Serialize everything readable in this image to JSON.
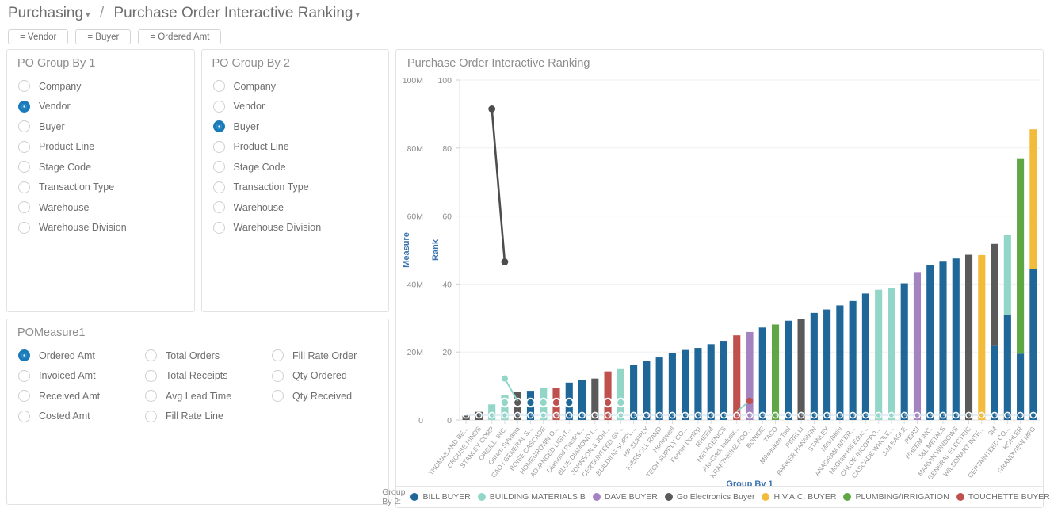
{
  "breadcrumb": {
    "items": [
      {
        "label": "Purchasing",
        "caret": "▾"
      },
      {
        "label": "Purchase Order Interactive Ranking",
        "caret": "▾"
      }
    ],
    "separator": "/"
  },
  "chips": [
    {
      "label": "= Vendor"
    },
    {
      "label": "= Buyer"
    },
    {
      "label": "= Ordered Amt"
    }
  ],
  "group_by_1": {
    "title": "PO Group By 1",
    "selected": "Vendor",
    "options": [
      "Company",
      "Vendor",
      "Buyer",
      "Product Line",
      "Stage Code",
      "Transaction Type",
      "Warehouse",
      "Warehouse Division"
    ]
  },
  "group_by_2": {
    "title": "PO Group By 2",
    "selected": "Buyer",
    "options": [
      "Company",
      "Vendor",
      "Buyer",
      "Product Line",
      "Stage Code",
      "Transaction Type",
      "Warehouse",
      "Warehouse Division"
    ]
  },
  "measure": {
    "title": "POMeasure1",
    "selected": "Ordered Amt",
    "columns": [
      [
        "Ordered Amt",
        "Invoiced Amt",
        "Received Amt",
        "Costed Amt"
      ],
      [
        "Total Orders",
        "Total Receipts",
        "Avg Lead Time",
        "Fill Rate Line"
      ],
      [
        "Fill Rate Order",
        "Qty Ordered",
        "Qty Received"
      ]
    ]
  },
  "chart_panel": {
    "title": "Purchase Order Interactive Ranking"
  },
  "chart_data": {
    "type": "bar",
    "title": "Purchase Order Interactive Ranking",
    "xlabel": "Group By 1",
    "y_left_label": "Measure",
    "y_right_label": "Rank",
    "y_left_ticks": [
      "0",
      "20M",
      "40M",
      "60M",
      "80M",
      "100M"
    ],
    "y_right_ticks": [
      "0",
      "20",
      "40",
      "60",
      "80",
      "100"
    ],
    "ylim": [
      0,
      100
    ],
    "grid": true,
    "legend_position": "bottom",
    "legend_title": "Group By 2:",
    "series_colors": {
      "BILL BUYER": "#1f6699",
      "BUILDING MATERIALS B": "#92d6c8",
      "DAVE BUYER": "#a383c0",
      "Go Electronics Buyer": "#5a5a5a",
      "H.V.A.C. BUYER": "#f2bb3a",
      "PLUMBING/IRRIGATION": "#5fa744",
      "TOUCHETTE BUYER": "#c0504d"
    },
    "legend": [
      {
        "label": "BILL BUYER",
        "color": "#1f6699"
      },
      {
        "label": "BUILDING MATERIALS B",
        "color": "#92d6c8"
      },
      {
        "label": "DAVE BUYER",
        "color": "#a383c0"
      },
      {
        "label": "Go Electronics Buyer",
        "color": "#5a5a5a"
      },
      {
        "label": "H.V.A.C. BUYER",
        "color": "#f2bb3a"
      },
      {
        "label": "PLUMBING/IRRIGATION",
        "color": "#5fa744"
      },
      {
        "label": "TOUCHETTE BUYER",
        "color": "#c0504d"
      }
    ],
    "categories": [
      "THOMAS AND BE...",
      "CROUSE HINDS",
      "STANLEY CORP",
      "ORGILL, INC.",
      "Osram Sylvania",
      "CAO / GENERAL S...",
      "BOISE CASCADE",
      "HOMEGROWN O...",
      "ADVANCED LIGHT...",
      "Diamond Plastics...",
      "BLUE DIAMOND I...",
      "JOHNSON & JOH...",
      "CERTAINTEED GY...",
      "BUILDING SUPPL...",
      "HP SUPPLY",
      "IGERSOLL RAND",
      "Honeywell",
      "TECH SUPPLY CO...",
      "Fenner Dunlop",
      "RHEEM",
      "METAGENICS",
      "Ato-Clark Industr...",
      "KRAFTHEINZ FOO...",
      "BONIDE",
      "TACO",
      "Milwaukee Tool",
      "PIRELLI",
      "PARKER HANNIFIN",
      "STANLEY",
      "Mitsubishi",
      "ANAGRAM INTER...",
      "McGraw-Hill Educ...",
      "CHLOE INCORPO...",
      "CASCADE WHOLE...",
      "J-M EAGLE",
      "PEPSI",
      "RHEEM INC.",
      "J&L METALS",
      "MARVIN WINDOWS",
      "GENERAL ELECTRIC",
      "WILSONART INTE...",
      "3M",
      "CERTAINTEED CO...",
      "KOHLER",
      "GRANDVIEW MFG"
    ],
    "bar_segments": [
      [
        {
          "s": "Go Electronics Buyer",
          "v": 1.3
        }
      ],
      [
        {
          "s": "Go Electronics Buyer",
          "v": 2.4
        }
      ],
      [
        {
          "s": "BUILDING MATERIALS B",
          "v": 4.6
        }
      ],
      [
        {
          "s": "BUILDING MATERIALS B",
          "v": 7.3
        }
      ],
      [
        {
          "s": "Go Electronics Buyer",
          "v": 8.2
        }
      ],
      [
        {
          "s": "BILL BUYER",
          "v": 8.6
        }
      ],
      [
        {
          "s": "BUILDING MATERIALS B",
          "v": 9.4
        }
      ],
      [
        {
          "s": "TOUCHETTE BUYER",
          "v": 9.5
        }
      ],
      [
        {
          "s": "BILL BUYER",
          "v": 11.0
        }
      ],
      [
        {
          "s": "BILL BUYER",
          "v": 11.7
        }
      ],
      [
        {
          "s": "Go Electronics Buyer",
          "v": 12.2
        }
      ],
      [
        {
          "s": "TOUCHETTE BUYER",
          "v": 14.3
        }
      ],
      [
        {
          "s": "BUILDING MATERIALS B",
          "v": 15.2
        }
      ],
      [
        {
          "s": "BILL BUYER",
          "v": 16.1
        }
      ],
      [
        {
          "s": "BILL BUYER",
          "v": 17.3
        }
      ],
      [
        {
          "s": "BILL BUYER",
          "v": 18.4
        }
      ],
      [
        {
          "s": "BILL BUYER",
          "v": 19.6
        }
      ],
      [
        {
          "s": "BILL BUYER",
          "v": 20.6
        }
      ],
      [
        {
          "s": "BILL BUYER",
          "v": 21.2
        }
      ],
      [
        {
          "s": "BILL BUYER",
          "v": 22.3
        }
      ],
      [
        {
          "s": "BILL BUYER",
          "v": 23.3
        }
      ],
      [
        {
          "s": "TOUCHETTE BUYER",
          "v": 24.9
        }
      ],
      [
        {
          "s": "DAVE BUYER",
          "v": 25.9
        }
      ],
      [
        {
          "s": "BILL BUYER",
          "v": 27.2
        }
      ],
      [
        {
          "s": "PLUMBING/IRRIGATION",
          "v": 28.1
        }
      ],
      [
        {
          "s": "BILL BUYER",
          "v": 29.2
        }
      ],
      [
        {
          "s": "Go Electronics Buyer",
          "v": 29.8
        }
      ],
      [
        {
          "s": "BILL BUYER",
          "v": 31.5
        }
      ],
      [
        {
          "s": "BILL BUYER",
          "v": 32.5
        }
      ],
      [
        {
          "s": "BILL BUYER",
          "v": 33.7
        }
      ],
      [
        {
          "s": "BILL BUYER",
          "v": 35.0
        }
      ],
      [
        {
          "s": "BILL BUYER",
          "v": 37.2
        }
      ],
      [
        {
          "s": "BUILDING MATERIALS B",
          "v": 38.3
        }
      ],
      [
        {
          "s": "BUILDING MATERIALS B",
          "v": 38.8
        }
      ],
      [
        {
          "s": "BILL BUYER",
          "v": 40.2
        }
      ],
      [
        {
          "s": "DAVE BUYER",
          "v": 43.5
        }
      ],
      [
        {
          "s": "BILL BUYER",
          "v": 45.5
        }
      ],
      [
        {
          "s": "BILL BUYER",
          "v": 46.8
        }
      ],
      [
        {
          "s": "BILL BUYER",
          "v": 47.5
        }
      ],
      [
        {
          "s": "Go Electronics Buyer",
          "v": 48.6
        }
      ],
      [
        {
          "s": "H.V.A.C. BUYER",
          "v": 48.5
        }
      ],
      [
        {
          "s": "BILL BUYER",
          "v": 22.0
        },
        {
          "s": "Go Electronics Buyer",
          "v": 29.8
        }
      ],
      [
        {
          "s": "BILL BUYER",
          "v": 31.0
        },
        {
          "s": "BUILDING MATERIALS B",
          "v": 23.5
        }
      ],
      [
        {
          "s": "BILL BUYER",
          "v": 19.5
        },
        {
          "s": "PLUMBING/IRRIGATION",
          "v": 57.5
        }
      ],
      [
        {
          "s": "BILL BUYER",
          "v": 44.5
        },
        {
          "s": "H.V.A.C. BUYER",
          "v": 41.0
        }
      ]
    ],
    "rank_line": {
      "label": "Rank",
      "color": "#4d4d4d",
      "points": [
        {
          "x": 2,
          "y": 91.5
        },
        {
          "x": 3,
          "y": 46.5
        }
      ]
    },
    "rank_markers_note": "small ring markers at bar bases and a light-teal rank segment near left"
  }
}
